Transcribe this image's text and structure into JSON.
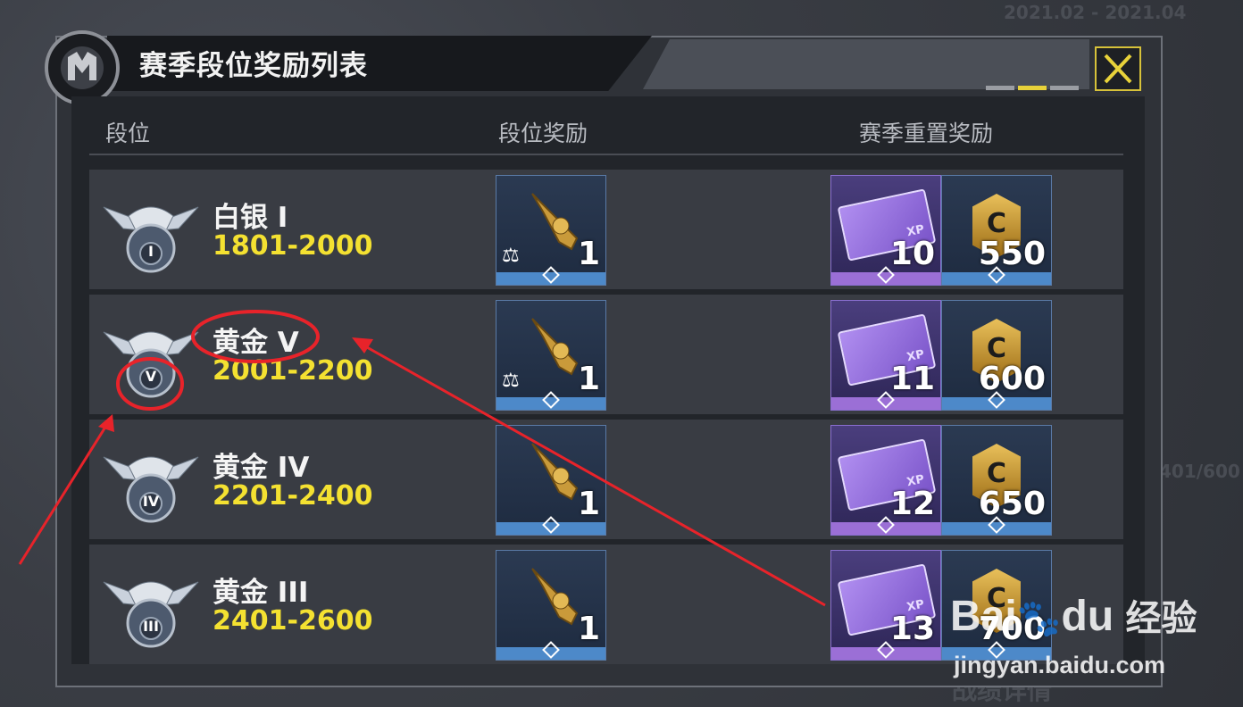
{
  "background": {
    "date_range": "2021.02 - 2021.04",
    "progress": "401/600",
    "bottom_right": "战绩详情"
  },
  "modal": {
    "title": "赛季段位奖励列表",
    "close_label": "✕",
    "pager_count": 3,
    "pager_active": 1
  },
  "table": {
    "headers": [
      "段位",
      "段位奖励",
      "赛季重置奖励"
    ],
    "rows": [
      {
        "rank_name": "白银 I",
        "score_range": "1801-2000",
        "emblem_numeral": "I",
        "rank_reward": {
          "item": "gold-revolver-icon",
          "qty": "1",
          "blueprint": true
        },
        "reset_rewards": [
          {
            "item": "xp-card-icon",
            "qty": "10"
          },
          {
            "item": "cod-coin-icon",
            "qty": "550"
          }
        ]
      },
      {
        "rank_name": "黄金 V",
        "score_range": "2001-2200",
        "emblem_numeral": "V",
        "rank_reward": {
          "item": "gold-sniper-rifle-icon",
          "qty": "1",
          "blueprint": true
        },
        "reset_rewards": [
          {
            "item": "xp-card-icon",
            "qty": "11"
          },
          {
            "item": "cod-coin-icon",
            "qty": "600"
          }
        ]
      },
      {
        "rank_name": "黄金 IV",
        "score_range": "2201-2400",
        "emblem_numeral": "IV",
        "rank_reward": {
          "item": "gold-arm-wrap-icon",
          "qty": "1",
          "blueprint": false
        },
        "reset_rewards": [
          {
            "item": "xp-card-icon",
            "qty": "12"
          },
          {
            "item": "cod-coin-icon",
            "qty": "650"
          }
        ]
      },
      {
        "rank_name": "黄金 III",
        "score_range": "2401-2600",
        "emblem_numeral": "III",
        "rank_reward": {
          "item": "gold-grenade-icon",
          "qty": "1",
          "blueprint": false
        },
        "reset_rewards": [
          {
            "item": "xp-card-icon",
            "qty": "13"
          },
          {
            "item": "cod-coin-icon",
            "qty": "700"
          }
        ]
      }
    ]
  },
  "labels": {
    "xp": "XP",
    "coin": "C",
    "blueprint": "⚖"
  },
  "watermark": {
    "brand": "Bai",
    "brand2": "du",
    "cn": "经验",
    "url": "jingyan.baidu.com"
  },
  "colors": {
    "accent_yellow": "#f4e131",
    "annotation_red": "#e8232a",
    "tile_blue": "#4d89c9",
    "tile_purple": "#9b6fd6"
  }
}
